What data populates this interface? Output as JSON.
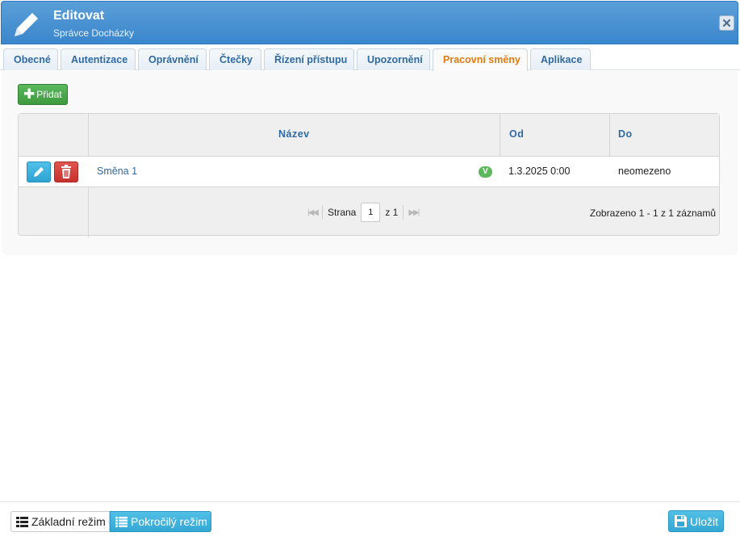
{
  "header": {
    "title": "Editovat",
    "subtitle": "Správce Docházky"
  },
  "tabs": [
    {
      "label": "Obecné"
    },
    {
      "label": "Autentizace"
    },
    {
      "label": "Oprávnění"
    },
    {
      "label": "Čtečky"
    },
    {
      "label": "Řízení přístupu"
    },
    {
      "label": "Upozornění"
    },
    {
      "label": "Pracovní směny",
      "active": true
    },
    {
      "label": "Aplikace"
    }
  ],
  "toolbar": {
    "add_label": "Přidat"
  },
  "grid": {
    "columns": [
      "Název",
      "Od",
      "Do"
    ],
    "rows": [
      {
        "name": "Směna 1",
        "badge": "V",
        "from": "1.3.2025 0:00",
        "to": "neomezeno"
      }
    ],
    "pager": {
      "page_label": "Strana",
      "page": "1",
      "of_label": "z 1"
    },
    "records": "Zobrazeno 1 - 1 z 1 záznamů"
  },
  "footer": {
    "basic_mode": "Základní režim",
    "advanced_mode": "Pokročilý režim",
    "save_label": "Uložit"
  },
  "colors": {
    "header": "#3a86cc",
    "active_tab": "#e07b12",
    "add_button": "#5cb85c",
    "delete_button": "#c9302c",
    "info_button": "#33a8d4"
  }
}
